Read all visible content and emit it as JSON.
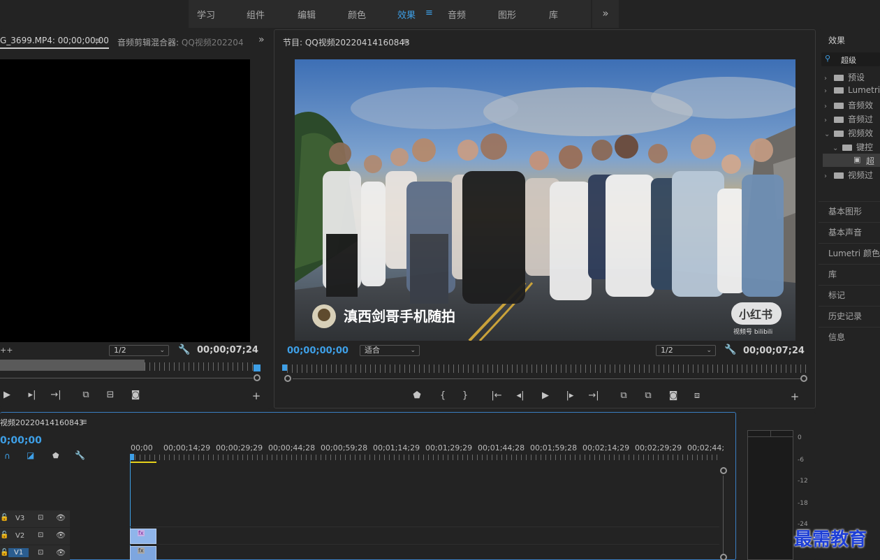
{
  "workspace": {
    "tabs": [
      "学习",
      "组件",
      "编辑",
      "颜色",
      "效果",
      "音频",
      "图形",
      "库"
    ],
    "active": "效果",
    "menu_icon": "≡",
    "more_icon": "»"
  },
  "source_panel": {
    "tab_source": "G_3699.MP4: 00;00;00;00",
    "tab_mixer": "音频剪辑混合器:",
    "tab_mixer_target": "QQ视频202204",
    "resolution": "1/2",
    "timecode": "00;00;07;24",
    "prefix_glyph": "++"
  },
  "program_panel": {
    "title": "节目: QQ视频20220414160843",
    "timecode_current": "00;00;00;00",
    "fit": "适合",
    "resolution": "1/2",
    "timecode_duration": "00;00;07;24",
    "video_caption": "滇西剑哥手机随拍",
    "video_logo": "小红书",
    "video_logo_sub": "视频号 bilibili"
  },
  "effects_panel": {
    "title": "效果",
    "search_value": "超级",
    "tree": [
      {
        "label": "预设",
        "expanded": false,
        "level": 0
      },
      {
        "label": "Lumetri",
        "expanded": false,
        "level": 0
      },
      {
        "label": "音频效",
        "expanded": false,
        "level": 0
      },
      {
        "label": "音频过",
        "expanded": false,
        "level": 0
      },
      {
        "label": "视频效",
        "expanded": true,
        "level": 0
      },
      {
        "label": "键控",
        "expanded": true,
        "level": 1
      },
      {
        "label": "超",
        "expanded": false,
        "level": 2
      },
      {
        "label": "视频过",
        "expanded": false,
        "level": 0
      }
    ],
    "sections": [
      "基本图形",
      "基本声音",
      "Lumetri 颜色",
      "库",
      "标记",
      "历史记录",
      "信息"
    ]
  },
  "timeline": {
    "sequence_name": "视频20220414160843",
    "timecode": "0;00;00",
    "ruler_labels": [
      "00;00",
      "00;00;14;29",
      "00;00;29;29",
      "00;00;44;28",
      "00;00;59;28",
      "00;01;14;29",
      "00;01;29;29",
      "00;01;44;28",
      "00;01;59;28",
      "00;02;14;29",
      "00;02;29;29",
      "00;02;44;"
    ],
    "tracks": [
      {
        "name": "V3",
        "has_clip": false,
        "clip_badge": ""
      },
      {
        "name": "V2",
        "has_clip": true,
        "clip_badge": "fx"
      },
      {
        "name": "V1",
        "has_clip": true,
        "clip_badge": "fx"
      }
    ]
  },
  "meters": {
    "labels": [
      "0",
      "-6",
      "-12",
      "-18",
      "-24"
    ]
  },
  "watermark": "最需教育",
  "colors": {
    "accent": "#3e9fe6",
    "panel_bg": "#232323",
    "clip": "#8fb5ea",
    "playhead_range": "#e6d21b"
  }
}
